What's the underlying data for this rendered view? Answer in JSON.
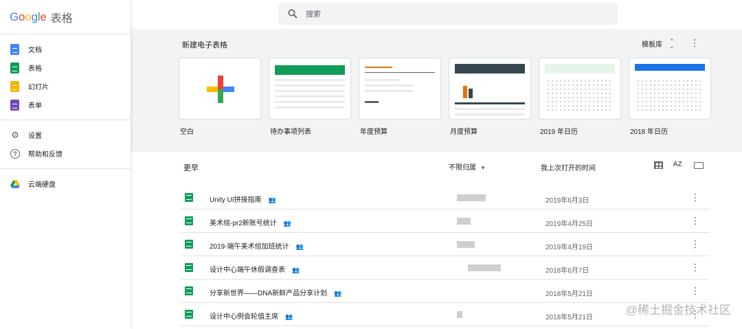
{
  "brand": {
    "logo_text": "Google",
    "product": "表格"
  },
  "sidebar": {
    "apps": [
      {
        "label": "文档",
        "icon": "docs-icon"
      },
      {
        "label": "表格",
        "icon": "sheets-icon"
      },
      {
        "label": "幻灯片",
        "icon": "slides-icon"
      },
      {
        "label": "表单",
        "icon": "forms-icon"
      }
    ],
    "settings": [
      {
        "label": "设置",
        "icon": "gear-icon"
      },
      {
        "label": "帮助和反馈",
        "icon": "help-icon"
      }
    ],
    "drive": {
      "label": "云端硬盘",
      "icon": "drive-icon"
    }
  },
  "search": {
    "placeholder": "搜索"
  },
  "templates": {
    "heading": "新建电子表格",
    "gallery_label": "模板库",
    "items": [
      {
        "label": "空白"
      },
      {
        "label": "待办事项列表"
      },
      {
        "label": "年度预算"
      },
      {
        "label": "月度预算"
      },
      {
        "label": "2019 年日历"
      },
      {
        "label": "2018 年日历"
      }
    ]
  },
  "files": {
    "heading": "更早",
    "owner_filter": "不限归属",
    "sort_label": "我上次打开的时间",
    "sort_icon_text": "AZ",
    "rows": [
      {
        "name": "Unity UI拼接指南",
        "date": "2019年6月3日"
      },
      {
        "name": "美术组-pr2新账号统计",
        "date": "2019年4月25日"
      },
      {
        "name": "2019-端午美术组加班统计",
        "date": "2019年4月19日"
      },
      {
        "name": "设计中心端午休假调查表",
        "date": "2018年6月7日"
      },
      {
        "name": "分享新世界——DNA新鲜产品分享计划",
        "date": "2018年5月21日"
      },
      {
        "name": "设计中心例会轮值主席",
        "date": "2018年5月21日"
      }
    ]
  },
  "watermark": "@稀土掘金技术社区",
  "colors": {
    "sheets_green": "#0f9d58",
    "docs_blue": "#4285f4",
    "slides_yellow": "#f4b400",
    "forms_purple": "#7248b9",
    "strip_bg": "#f1f3f4"
  }
}
